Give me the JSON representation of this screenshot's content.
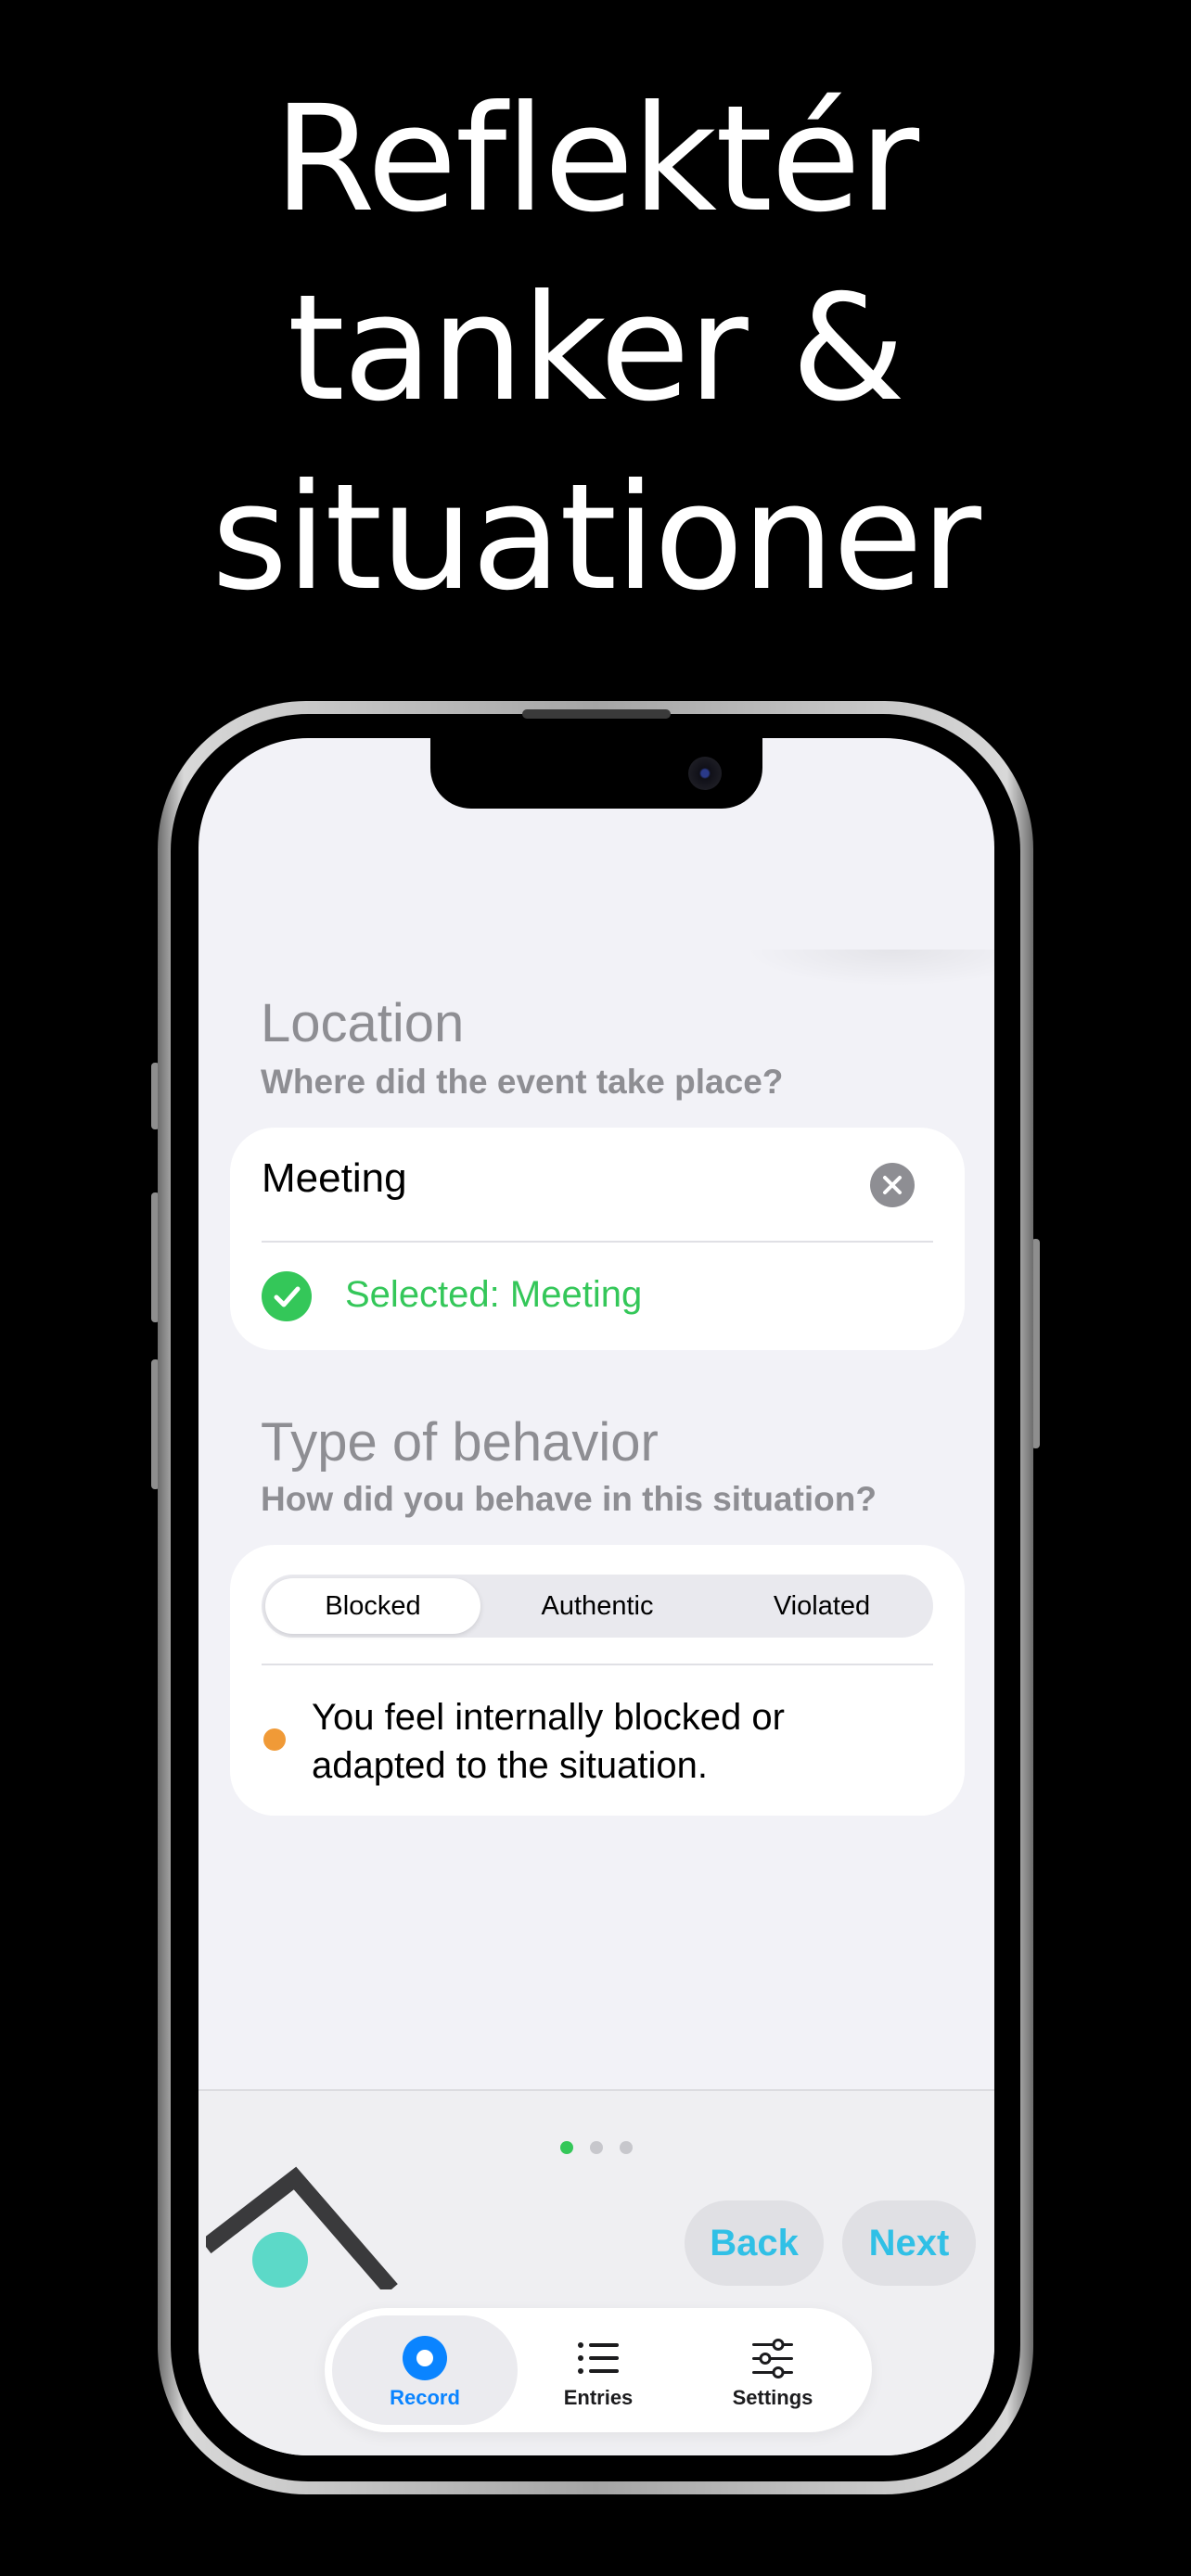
{
  "headline": {
    "line1": "Reflektér",
    "line2": "tanker &",
    "line3": "situationer"
  },
  "location": {
    "title": "Location",
    "subtitle": "Where did the event take place?",
    "field_value": "Meeting",
    "selected_text": "Selected: Meeting"
  },
  "behavior": {
    "title": "Type of behavior",
    "subtitle": "How did you behave in this situation?",
    "options": [
      "Blocked",
      "Authentic",
      "Violated"
    ],
    "selected_option": "Blocked",
    "description": "You feel internally blocked or adapted to the situation."
  },
  "pager": {
    "total": 3,
    "current": 1
  },
  "nav": {
    "back_label": "Back",
    "next_label": "Next"
  },
  "tabbar": {
    "tabs": [
      {
        "label": "Record",
        "icon": "record-icon",
        "active": true
      },
      {
        "label": "Entries",
        "icon": "list-icon",
        "active": false
      },
      {
        "label": "Settings",
        "icon": "sliders-icon",
        "active": false
      }
    ]
  },
  "colors": {
    "accent_green": "#34c759",
    "accent_blue": "#0a84ff",
    "button_text": "#30c0e6",
    "orange": "#f09a37",
    "teal": "#5cd9c8"
  }
}
